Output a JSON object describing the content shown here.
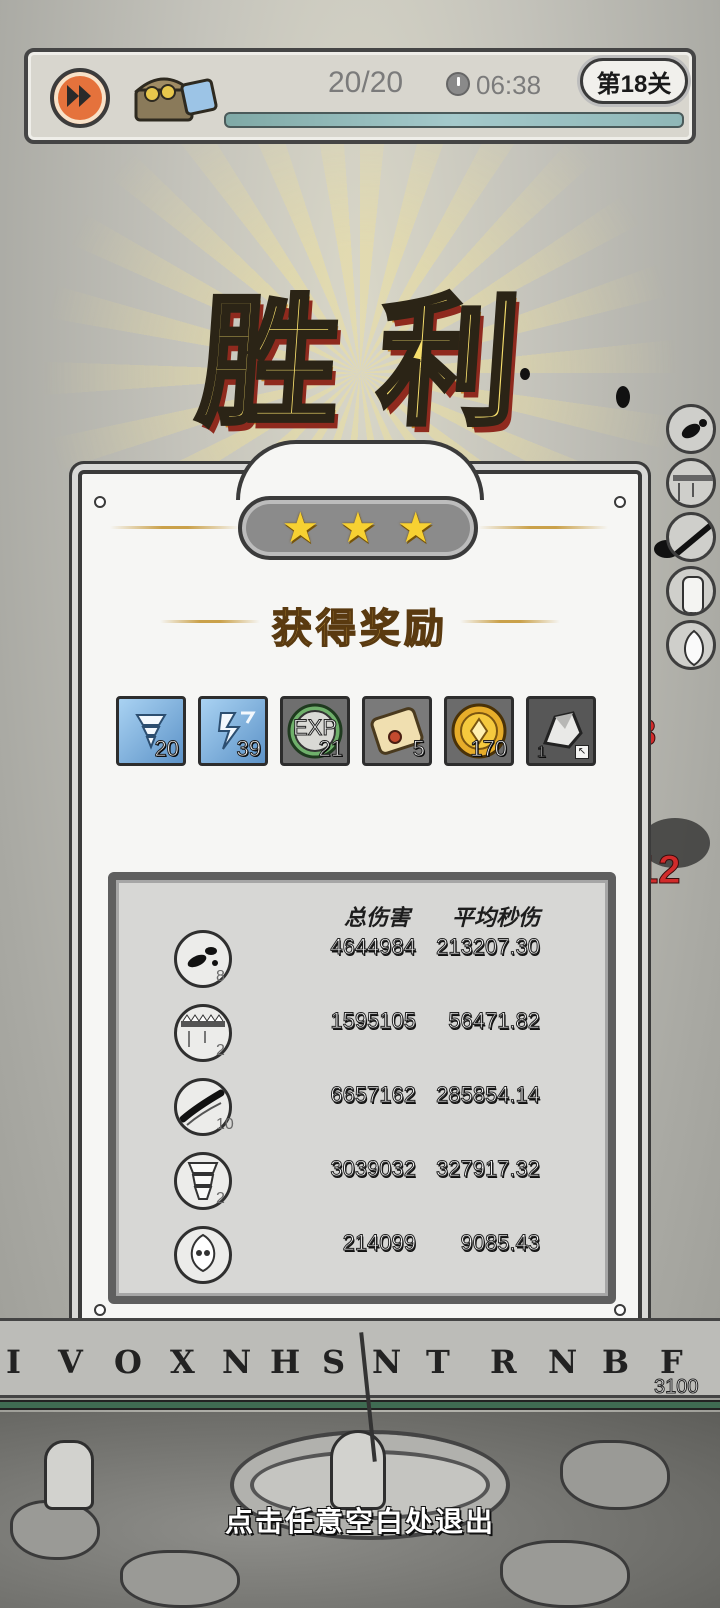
{
  "hud": {
    "wave": "20/20",
    "time": "06:38",
    "stage": "第18关",
    "fast_forward_icon": "fast-forward-icon",
    "chest_icon": "treasure-chest-icon",
    "timer_icon": "clock-icon"
  },
  "victory_title": "胜利",
  "stars": {
    "earned": 3,
    "total": 3
  },
  "rewards_title": "获得奖励",
  "rewards": [
    {
      "icon": "tornado-ice-icon",
      "qty": "20"
    },
    {
      "icon": "lightning-ice-icon",
      "qty": "39"
    },
    {
      "icon": "exp-orb-icon",
      "label": "EXP",
      "qty": "21"
    },
    {
      "icon": "scroll-icon",
      "qty": "5"
    },
    {
      "icon": "gold-coin-icon",
      "qty": "170"
    },
    {
      "icon": "stone-ore-icon",
      "qty": "1"
    }
  ],
  "stats": {
    "headers": {
      "total_damage": "总伤害",
      "avg_dps": "平均秒伤"
    },
    "rows": [
      {
        "icon": "ink-splash-icon",
        "level": "8",
        "total": "4644984",
        "dps": "213207.30"
      },
      {
        "icon": "spike-trap-icon",
        "level": "2",
        "total": "1595105",
        "dps": "56471.82"
      },
      {
        "icon": "ink-stroke-icon",
        "level": "10",
        "total": "6657162",
        "dps": "285854.14"
      },
      {
        "icon": "tornado-icon",
        "level": "2",
        "total": "3039032",
        "dps": "327917.32"
      },
      {
        "icon": "ghost-flame-icon",
        "level": "",
        "total": "214099",
        "dps": "9085.43"
      }
    ]
  },
  "runes": [
    "I",
    "V",
    "O",
    "X",
    "N",
    "H",
    "S",
    "N",
    "T",
    "R",
    "N",
    "B",
    "F"
  ],
  "base_hp": "3100",
  "exit_hint": "点击任意空白处退出",
  "colors": {
    "gold": "#f6de6c",
    "star": "#f7d132",
    "accent_orange": "#e5723c",
    "damage_red": "#d12b2b"
  }
}
